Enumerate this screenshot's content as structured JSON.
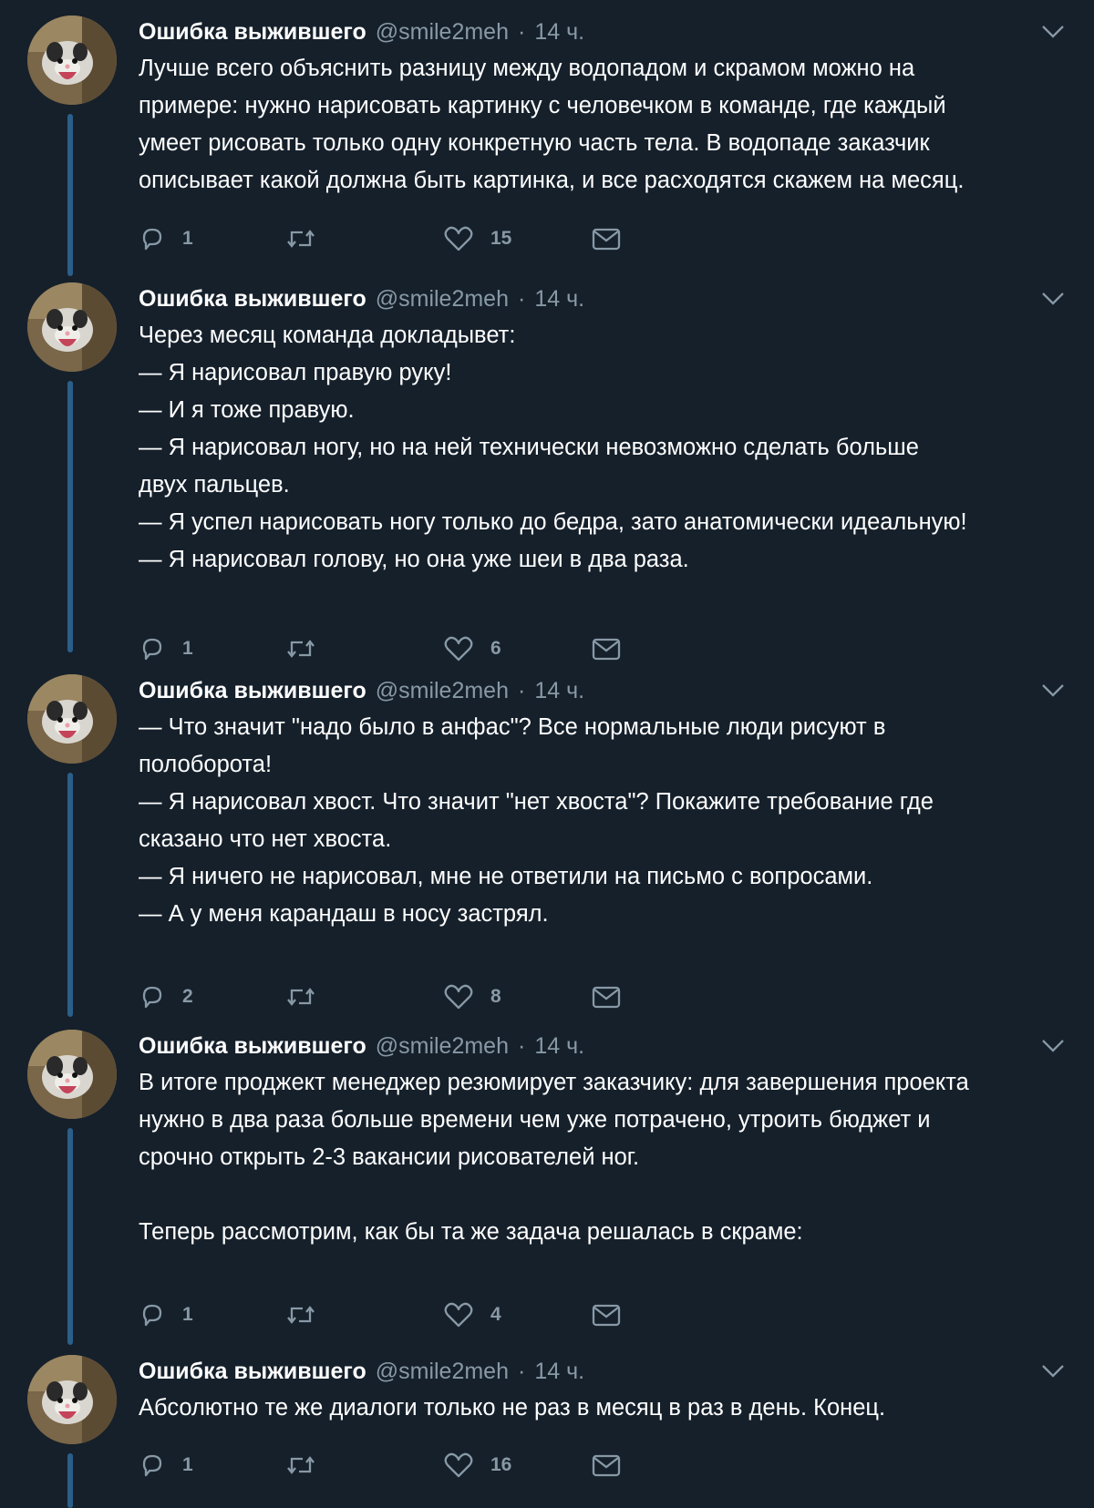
{
  "colors": {
    "background": "#15202b",
    "text": "#ffffff",
    "secondary": "#8899a6",
    "thread_line": "#2b5f8a"
  },
  "icons": {
    "reply": "reply-icon",
    "retweet": "retweet-icon",
    "like": "like-icon",
    "dm": "direct-message-icon",
    "menu": "chevron-down-icon"
  },
  "tweets": [
    {
      "author": "Ошибка выжившего",
      "handle": "@smile2meh",
      "separator": "·",
      "time": "14 ч.",
      "lines": [
        "Лучше всего объяснить разницу между водопадом и скрамом можно на",
        "примере: нужно нарисовать картинку с человечком в команде, где каждый",
        "умеет рисовать только одну конкретную часть тела. В водопаде заказчик",
        "описывает какой должна быть картинка, и все расходятся скажем на месяц."
      ],
      "replies": "1",
      "retweets": "",
      "likes": "15"
    },
    {
      "author": "Ошибка выжившего",
      "handle": "@smile2meh",
      "separator": "·",
      "time": "14 ч.",
      "lines": [
        "Через месяц команда докладывет:",
        "— Я нарисовал правую руку!",
        "— И я тоже правую.",
        "— Я нарисовал ногу, но на ней технически невозможно сделать больше",
        "двух пальцев.",
        "— Я успел нарисовать ногу только до бедра, зато анатомически идеальную!",
        "— Я нарисовал голову, но она уже шеи в два раза."
      ],
      "replies": "1",
      "retweets": "",
      "likes": "6"
    },
    {
      "author": "Ошибка выжившего",
      "handle": "@smile2meh",
      "separator": "·",
      "time": "14 ч.",
      "lines": [
        "— Что значит \"надо было в анфас\"? Все нормальные люди рисуют в",
        "полоборота!",
        "— Я нарисовал хвост. Что значит \"нет хвоста\"? Покажите требование где",
        "сказано что нет хвоста.",
        "— Я ничего не нарисовал, мне не ответили на письмо с вопросами.",
        "— А у меня карандаш в носу застрял."
      ],
      "replies": "2",
      "retweets": "",
      "likes": "8"
    },
    {
      "author": "Ошибка выжившего",
      "handle": "@smile2meh",
      "separator": "·",
      "time": "14 ч.",
      "lines": [
        "В итоге проджект менеджер резюмирует заказчику: для завершения проекта",
        "нужно в два раза больше времени чем уже потрачено, утроить бюджет и",
        "срочно открыть 2-3 вакансии рисователей ног.",
        "",
        "Теперь рассмотрим, как бы та же задача решалась в скраме:"
      ],
      "replies": "1",
      "retweets": "",
      "likes": "4"
    },
    {
      "author": "Ошибка выжившего",
      "handle": "@smile2meh",
      "separator": "·",
      "time": "14 ч.",
      "lines": [
        "Абсолютно те же диалоги только не раз в месяц в раз в день. Конец."
      ],
      "replies": "1",
      "retweets": "",
      "likes": "16"
    }
  ]
}
